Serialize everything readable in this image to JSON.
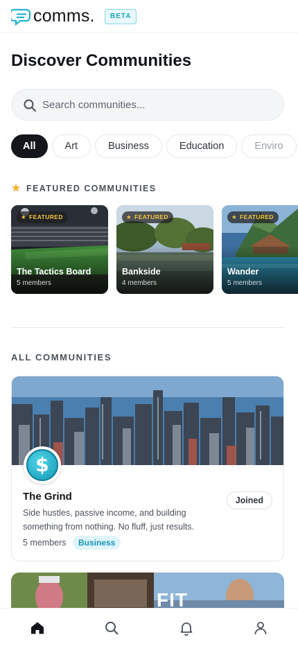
{
  "app": {
    "name": "comms.",
    "badge": "BETA"
  },
  "page": {
    "title": "Discover Communities"
  },
  "search": {
    "placeholder": "Search communities..."
  },
  "filters": [
    "All",
    "Art",
    "Business",
    "Education",
    "Enviro"
  ],
  "featured": {
    "label": "FEATURED COMMUNITIES",
    "badge": "FEATURED",
    "items": [
      {
        "name": "The Tactics Board",
        "members": "5 members"
      },
      {
        "name": "Bankside",
        "members": "4 members"
      },
      {
        "name": "Wander",
        "members": "5 members"
      }
    ]
  },
  "all": {
    "label": "ALL COMMUNITIES",
    "items": [
      {
        "name": "The Grind",
        "description": "Side hustles, passive income, and building something from nothing. No fluff, just results.",
        "members": "5 members",
        "tag": "Business",
        "status": "Joined",
        "avatar_symbol": "$"
      },
      {
        "banner_text": "FIT"
      }
    ]
  },
  "nav": {
    "items": [
      {
        "icon": "home-icon",
        "active": true
      },
      {
        "icon": "search-icon",
        "active": false
      },
      {
        "icon": "bell-icon",
        "active": false
      },
      {
        "icon": "user-icon",
        "active": false
      }
    ]
  },
  "colors": {
    "accent": "#1aa6c4",
    "dark": "#13171c",
    "featured_gold": "#f4c542"
  }
}
